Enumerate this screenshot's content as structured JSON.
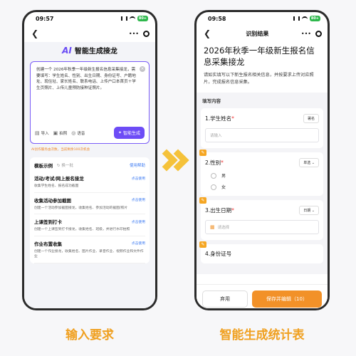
{
  "colors": {
    "accent_purple": "#6d4cf6",
    "accent_orange": "#f29128",
    "arrow_yellow": "#f5c23a",
    "caption_orange": "#f0a020",
    "link_blue": "#3d7bf3"
  },
  "left_phone": {
    "status_time": "09:57",
    "battery": "80+",
    "ai_logo": "AI",
    "title": "智能生成接龙",
    "input_text": "创建一个 2026年秋季一年级新生报名信息采集接龙，需要填写：学生姓名、性别、出生日期、身份证号、户籍地址、现住址、家长姓名、联系电话、上传户口本首页＋学生页照片、上传儿童预防接种证照片。",
    "tools": [
      {
        "icon": "import-icon",
        "label": "导入"
      },
      {
        "icon": "camera-icon",
        "label": "拍照"
      },
      {
        "icon": "mic-icon",
        "label": "语音"
      }
    ],
    "generate_label": "智能生成",
    "disclaimer": "AI创作服务由次数，当前剩余100次机会",
    "templates_title": "模板示例",
    "refresh_label": "换一批",
    "help_label": "使用帮助",
    "use_label": "点击使用",
    "templates": [
      {
        "name": "活动/考试/网上报名接龙",
        "desc": "收集学生姓名、报名成功截图"
      },
      {
        "name": "收集活动参加截图",
        "desc": "创建一个活动参加截图接龙，收集姓名、参加活动的截图/照片"
      },
      {
        "name": "上课签到打卡",
        "desc": "创建一个上课签到打卡接龙，收集姓名、班级，并进行水印拍照"
      },
      {
        "name": "作业布置收集",
        "desc": "创建一个作业接龙，收集姓名、图片作业、录音作业、视频作业和文件作业"
      }
    ]
  },
  "right_phone": {
    "status_time": "09:58",
    "battery": "80+",
    "nav_title": "识别结果",
    "doc_title": "2026年秋季一年级新生报名信息采集接龙",
    "doc_subtitle": "请如实填写以下新生报名相关信息，并按要求上传对应照片，完成报名信息采集。",
    "fill_title": "填写内容",
    "questions": [
      {
        "label": "1.学生姓名",
        "tag": "署名",
        "placeholder": "请输入"
      },
      {
        "label": "2.性别",
        "tag": "单选",
        "options": [
          "男",
          "女"
        ]
      },
      {
        "label": "3.出生日期",
        "tag": "日期",
        "placeholder": "请选择"
      }
    ],
    "partial_label": "4.身份证号",
    "discard_label": "弃用",
    "save_label": "保存并编辑（10）"
  },
  "captions": {
    "left": "输入要求",
    "right": "智能生成统计表"
  }
}
